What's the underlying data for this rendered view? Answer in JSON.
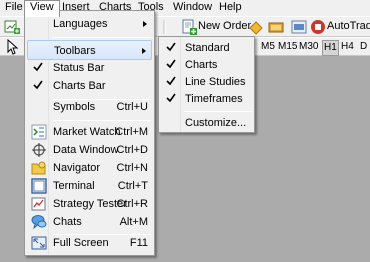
{
  "menubar": {
    "items": [
      "File",
      "View",
      "Insert",
      "Charts",
      "Tools",
      "Window",
      "Help"
    ]
  },
  "toolbar": {
    "new_order": "New Order",
    "autotrading": "AutoTradin",
    "timeframes": [
      "M5",
      "M15",
      "M30",
      "H1",
      "H4",
      "D"
    ]
  },
  "view_menu": {
    "items": [
      {
        "label": "Languages",
        "shortcut": "",
        "submenu": true
      },
      {
        "label": "Toolbars",
        "shortcut": "",
        "submenu": true,
        "highlighted": true
      },
      {
        "label": "Status Bar",
        "shortcut": "",
        "checked": true
      },
      {
        "label": "Charts Bar",
        "shortcut": "",
        "checked": true
      },
      {
        "label": "Symbols",
        "shortcut": "Ctrl+U"
      },
      {
        "label": "Market Watch",
        "shortcut": "Ctrl+M",
        "icon": "market-watch-icon"
      },
      {
        "label": "Data Window",
        "shortcut": "Ctrl+D",
        "icon": "crosshair-icon"
      },
      {
        "label": "Navigator",
        "shortcut": "Ctrl+N",
        "icon": "navigator-icon"
      },
      {
        "label": "Terminal",
        "shortcut": "Ctrl+T",
        "icon": "terminal-icon"
      },
      {
        "label": "Strategy Tester",
        "shortcut": "Ctrl+R",
        "icon": "strategy-tester-icon"
      },
      {
        "label": "Chats",
        "shortcut": "Alt+M",
        "icon": "chats-icon"
      },
      {
        "label": "Full Screen",
        "shortcut": "F11",
        "icon": "full-screen-icon"
      }
    ]
  },
  "toolbars_menu": {
    "items": [
      {
        "label": "Standard",
        "checked": true
      },
      {
        "label": "Charts",
        "checked": true
      },
      {
        "label": "Line Studies",
        "checked": true
      },
      {
        "label": "Timeframes",
        "checked": true
      },
      {
        "label": "Customize...",
        "checked": false
      }
    ]
  },
  "colors": {
    "highlight": "#d7e6f9",
    "menu_bg": "#f0f0f0",
    "workspace": "#ababab"
  }
}
